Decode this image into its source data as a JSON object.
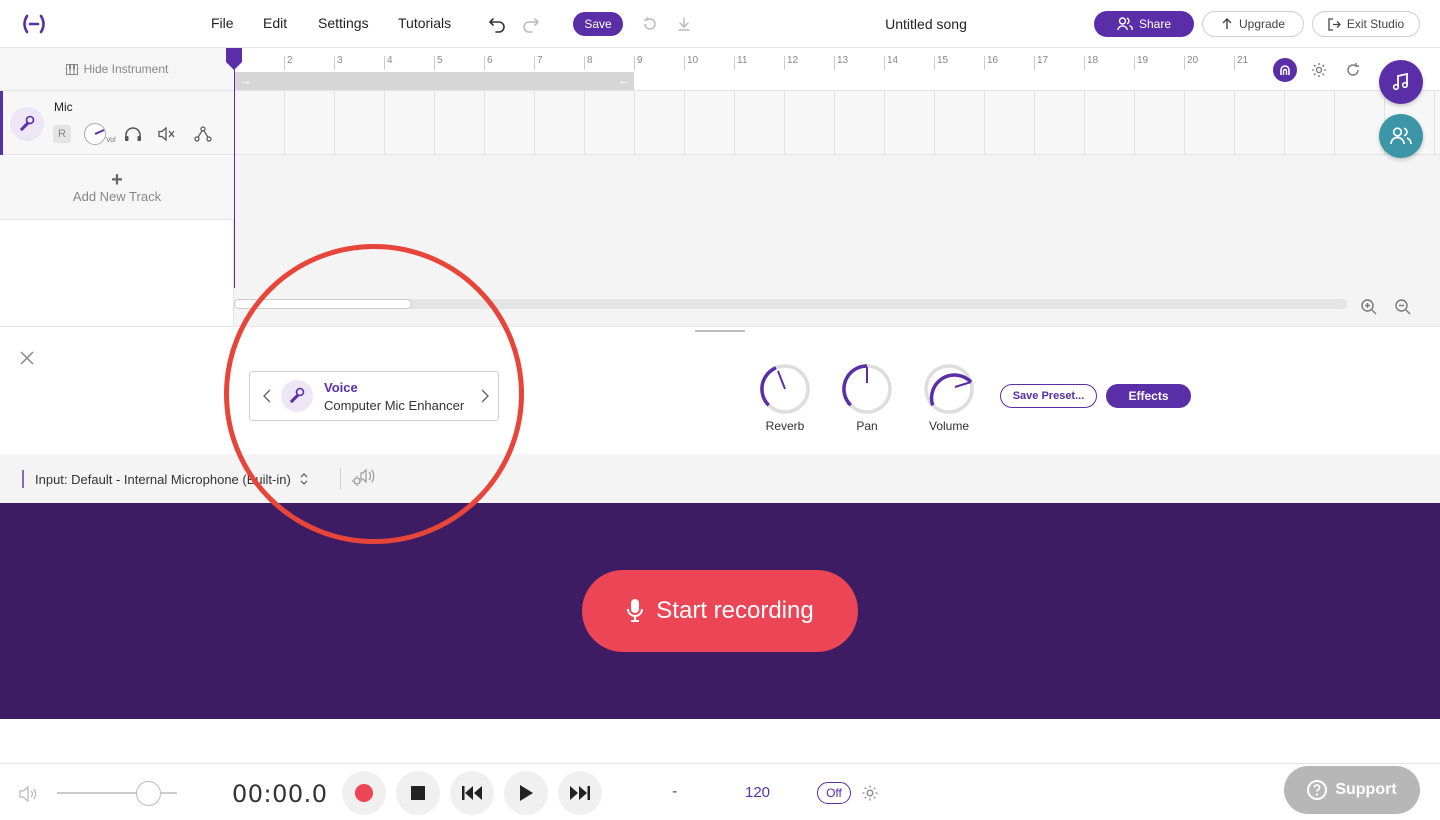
{
  "header": {
    "menu": [
      "File",
      "Edit",
      "Settings",
      "Tutorials"
    ],
    "save_label": "Save",
    "song_title": "Untitled song",
    "share_label": "Share",
    "upgrade_label": "Upgrade",
    "exit_label": "Exit Studio"
  },
  "tracks": {
    "hide_instrument_label": "Hide Instrument",
    "items": [
      {
        "name": "Mic",
        "record_label": "R",
        "volume_label": "Vol"
      }
    ],
    "add_track_plus": "+",
    "add_track_label": "Add New Track"
  },
  "timeline": {
    "bars": [
      "2",
      "3",
      "4",
      "5",
      "6",
      "7",
      "8",
      "9",
      "10",
      "11",
      "12",
      "13",
      "14",
      "15",
      "16",
      "17",
      "18",
      "19",
      "20",
      "21"
    ],
    "loop_start_arrow": "→",
    "loop_end_arrow": "←"
  },
  "instrument_panel": {
    "preset_category": "Voice",
    "preset_name": "Computer Mic Enhancer",
    "knobs": [
      {
        "label": "Reverb"
      },
      {
        "label": "Pan"
      },
      {
        "label": "Volume"
      }
    ],
    "save_preset_label": "Save Preset...",
    "effects_label": "Effects"
  },
  "input": {
    "label": "Input: Default - Internal Microphone (Built-in)"
  },
  "record": {
    "start_label": "Start recording"
  },
  "transport": {
    "time": "00:00.0",
    "key": "-",
    "tempo": "120",
    "metronome_label": "Off",
    "support_label": "Support"
  },
  "colors": {
    "brand": "#5a2ea6",
    "record_area": "#3d1c63",
    "record_button": "#ec4556",
    "annotation": "#e8453a",
    "teal_fab": "#3d96a8"
  }
}
